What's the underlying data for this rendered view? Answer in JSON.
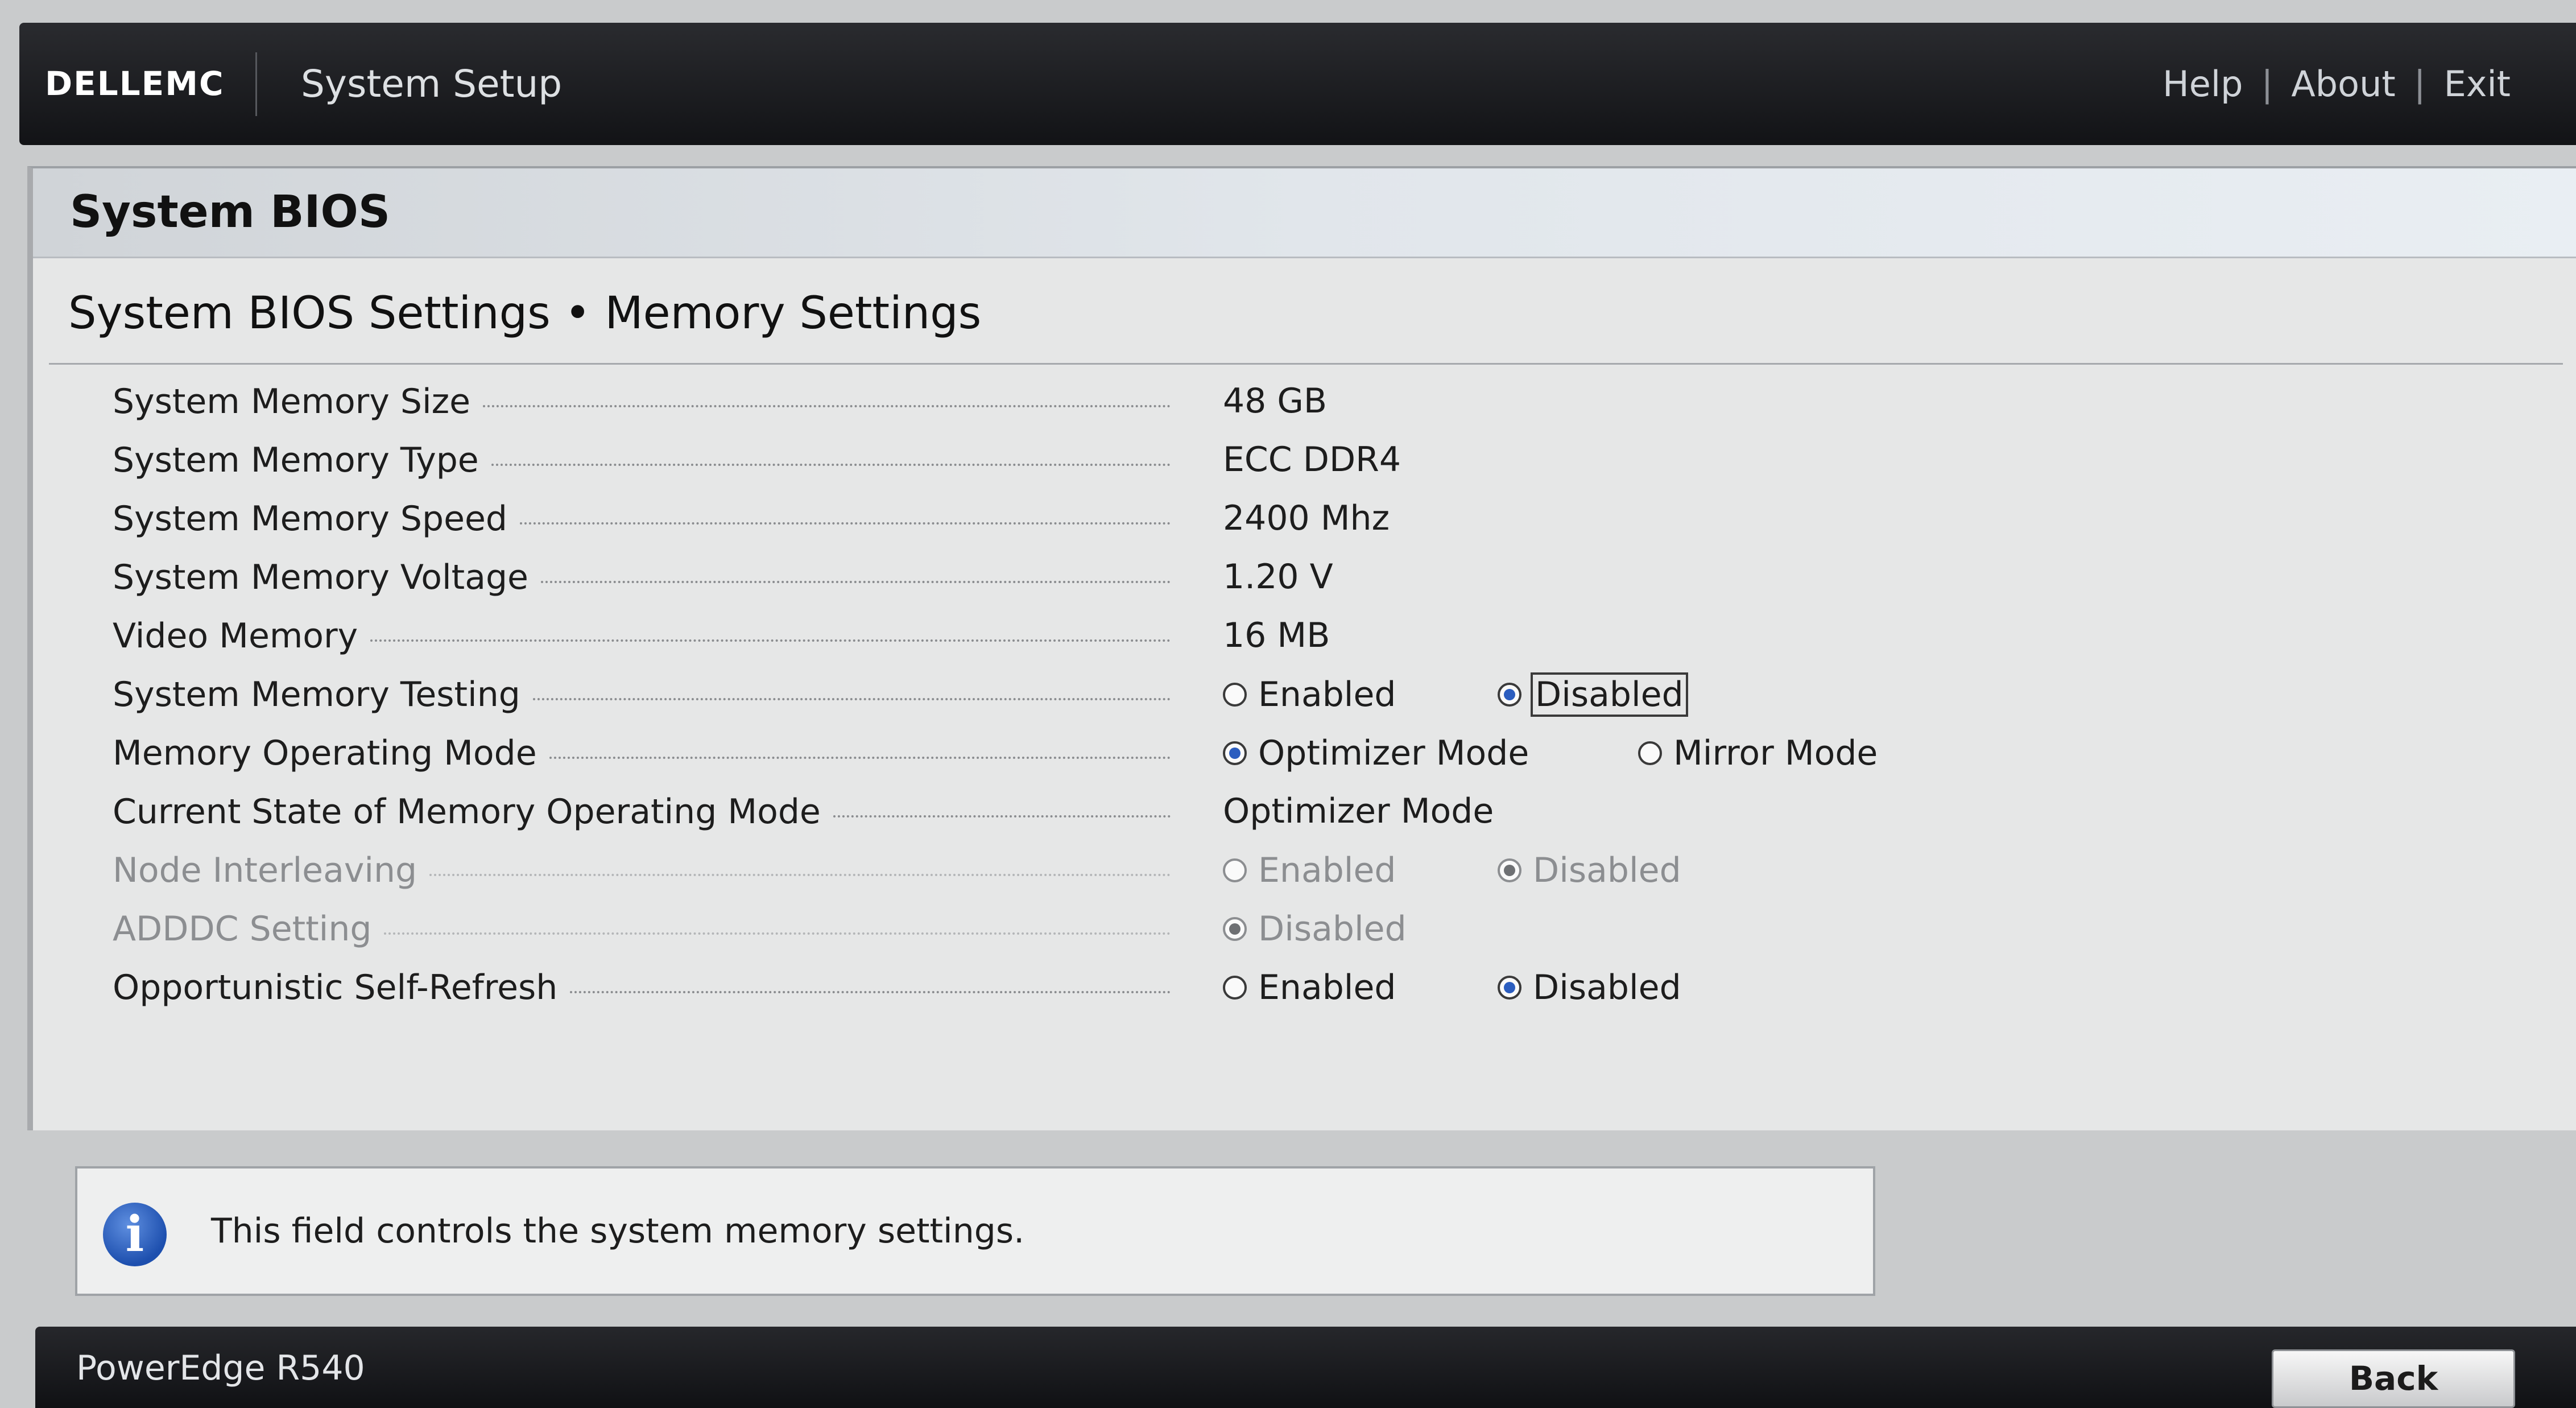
{
  "topbar": {
    "brand": "DELLEMC",
    "app_title": "System Setup",
    "links": [
      "Help",
      "About",
      "Exit"
    ],
    "separator": "|"
  },
  "section": {
    "title": "System BIOS"
  },
  "page": {
    "title": "System BIOS Settings • Memory Settings"
  },
  "settings": [
    {
      "label": "System Memory Size",
      "value": "48 GB"
    },
    {
      "label": "System Memory Type",
      "value": "ECC DDR4"
    },
    {
      "label": "System Memory Speed",
      "value": "2400 Mhz"
    },
    {
      "label": "System Memory Voltage",
      "value": "1.20 V"
    },
    {
      "label": "Video Memory",
      "value": "16 MB"
    },
    {
      "label": "System Memory Testing",
      "options": [
        "Enabled",
        "Disabled"
      ],
      "selected": "Disabled",
      "focused": "Disabled",
      "enabled": true
    },
    {
      "label": "Memory Operating Mode",
      "options": [
        "Optimizer Mode",
        "Mirror Mode"
      ],
      "selected": "Optimizer Mode",
      "enabled": true
    },
    {
      "label": "Current State of Memory Operating Mode",
      "value": "Optimizer Mode"
    },
    {
      "label": "Node Interleaving",
      "options": [
        "Enabled",
        "Disabled"
      ],
      "selected": "Disabled",
      "enabled": false
    },
    {
      "label": "ADDDC Setting",
      "options": [
        "Disabled"
      ],
      "selected": "Disabled",
      "enabled": false
    },
    {
      "label": "Opportunistic Self-Refresh",
      "options": [
        "Enabled",
        "Disabled"
      ],
      "selected": "Disabled",
      "enabled": true
    }
  ],
  "help": {
    "icon": "info-icon",
    "icon_glyph": "i",
    "text": "This field controls the system memory settings."
  },
  "footer": {
    "model": "PowerEdge R540",
    "back_label": "Back"
  },
  "colors": {
    "radio_selected": "#2b5dbf",
    "info_icon": "#1d4fae",
    "topbar": "#1a1b1f"
  }
}
